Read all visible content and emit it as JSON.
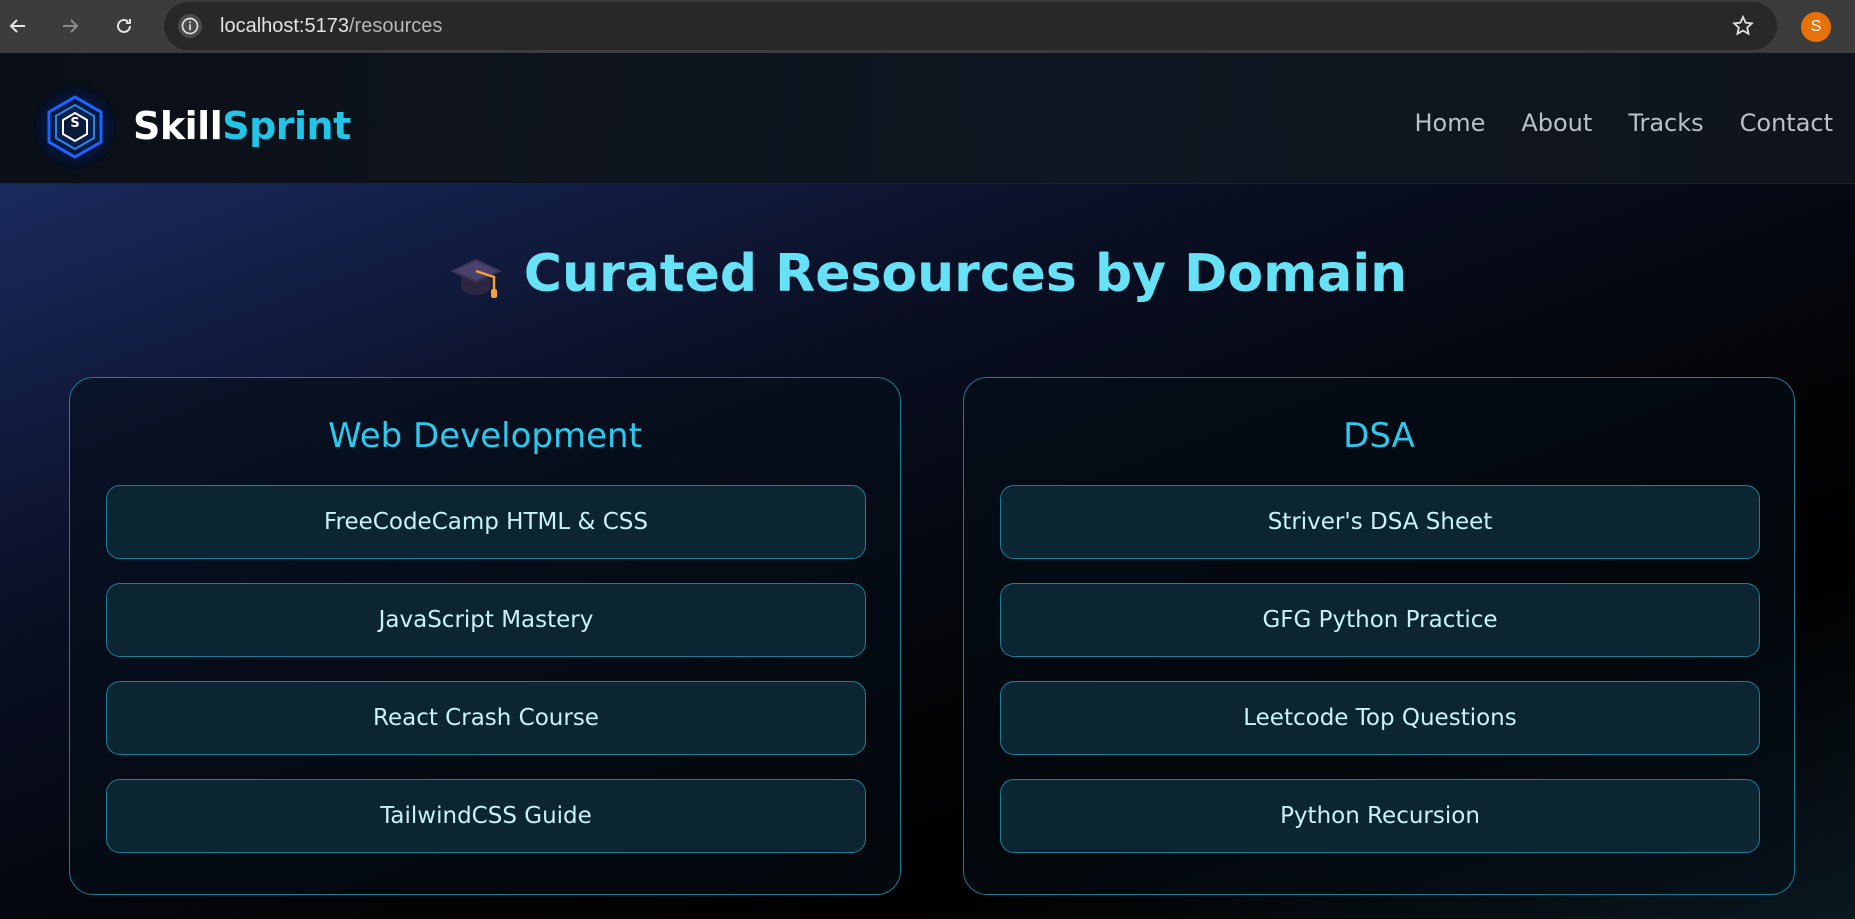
{
  "browser": {
    "url_host": "localhost:5173",
    "url_path": "/resources",
    "profile_initial": "S"
  },
  "site": {
    "brand_part1": "Skill",
    "brand_part2": "Sprint",
    "logo_letter": "S",
    "nav": [
      "Home",
      "About",
      "Tracks",
      "Contact"
    ]
  },
  "page": {
    "title": "Curated Resources by Domain",
    "title_icon": "graduation-cap-icon"
  },
  "domains": [
    {
      "title": "Web Development",
      "resources": [
        "FreeCodeCamp HTML & CSS",
        "JavaScript Mastery",
        "React Crash Course",
        "TailwindCSS Guide"
      ]
    },
    {
      "title": "DSA",
      "resources": [
        "Striver's DSA Sheet",
        "GFG Python Practice",
        "Leetcode Top Questions",
        "Python Recursion"
      ]
    }
  ],
  "colors": {
    "accent": "#22c5e8",
    "title": "#67e1f5",
    "profile": "#e8710a"
  }
}
